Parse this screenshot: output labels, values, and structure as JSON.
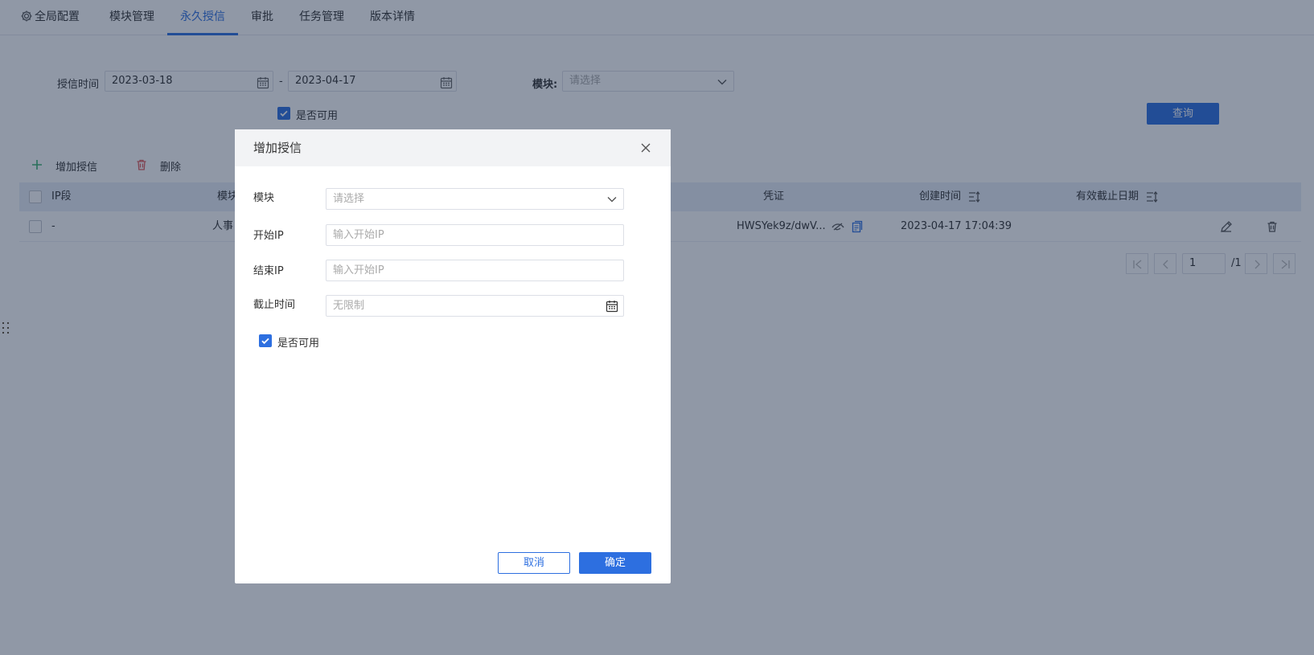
{
  "nav": {
    "tabs": [
      {
        "label": "全局配置"
      },
      {
        "label": "模块管理"
      },
      {
        "label": "永久授信"
      },
      {
        "label": "审批"
      },
      {
        "label": "任务管理"
      },
      {
        "label": "版本详情"
      }
    ],
    "active": "永久授信"
  },
  "filter": {
    "date_label": "授信时间",
    "start_date": "2023-03-18",
    "date_separator": "-",
    "end_date": "2023-04-17",
    "module_label": "模块:",
    "module_placeholder": "请选择",
    "enabled_label": "是否可用",
    "query_button": "查询"
  },
  "toolbar": {
    "add_label": "增加授信",
    "delete_label": "删除"
  },
  "table": {
    "columns": [
      "IP段",
      "模块",
      "凭证",
      "创建时间",
      "有效截止日期"
    ],
    "rows": [
      {
        "ip": "-",
        "module": "人事",
        "credential": "HWSYek9z/dwV...",
        "created": "2023-04-17 17:04:39",
        "expiry": ""
      }
    ]
  },
  "pagination": {
    "current_page": "1",
    "total": "/1"
  },
  "dialog": {
    "title": "增加授信",
    "module_label": "模块",
    "module_placeholder": "请选择",
    "start_ip_label": "开始IP",
    "start_ip_placeholder": "输入开始IP",
    "end_ip_label": "结束IP",
    "end_ip_placeholder": "输入开始IP",
    "deadline_label": "截止时间",
    "deadline_placeholder": "无限制",
    "enabled_label": "是否可用",
    "cancel_button": "取消",
    "confirm_button": "确定"
  },
  "colors": {
    "primary": "#2d6fe0",
    "add_icon": "#3cb371",
    "delete_icon": "#e05a5a"
  }
}
